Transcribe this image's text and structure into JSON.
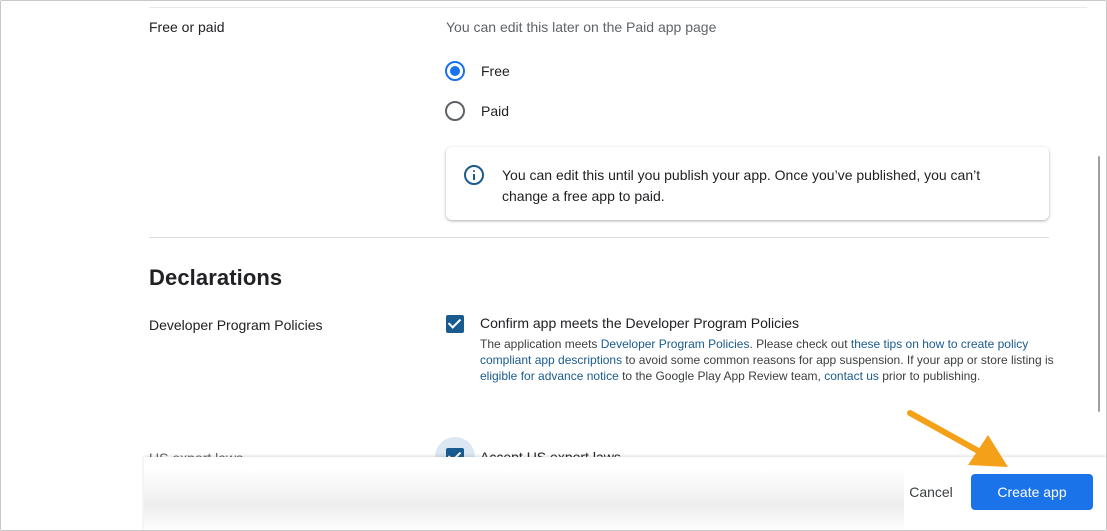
{
  "free_or_paid": {
    "label": "Free or paid",
    "hint": "You can edit this later on the Paid app page",
    "options": [
      {
        "label": "Free",
        "selected": true
      },
      {
        "label": "Paid",
        "selected": false
      }
    ],
    "info": "You can edit this until you publish your app. Once you’ve published, you can’t change a free app to paid."
  },
  "declarations": {
    "title": "Declarations",
    "dev_policies": {
      "label": "Developer Program Policies",
      "checkbox_label": "Confirm app meets the Developer Program Policies",
      "checked": true,
      "desc_1": "The application meets ",
      "link_1": "Developer Program Policies",
      "desc_2": ". Please check out ",
      "link_2": "these tips on how to create policy compliant app descriptions",
      "desc_3": " to avoid some common reasons for app suspension. If your app or store listing is ",
      "link_3": "eligible for advance notice",
      "desc_4": " to the Google Play App Review team, ",
      "link_4": "contact us",
      "desc_5": " prior to publishing."
    },
    "us_export": {
      "label": "US export laws",
      "checkbox_label": "Accept US export laws",
      "checked": true
    }
  },
  "footer": {
    "cancel_label": "Cancel",
    "create_label": "Create app"
  },
  "colors": {
    "accent": "#1a73e8",
    "checkbox": "#1a5b8f",
    "annotation_arrow": "#f4a019"
  },
  "icons": {
    "info": "info-circle-icon",
    "arrow": "orange-pointer-arrow"
  }
}
